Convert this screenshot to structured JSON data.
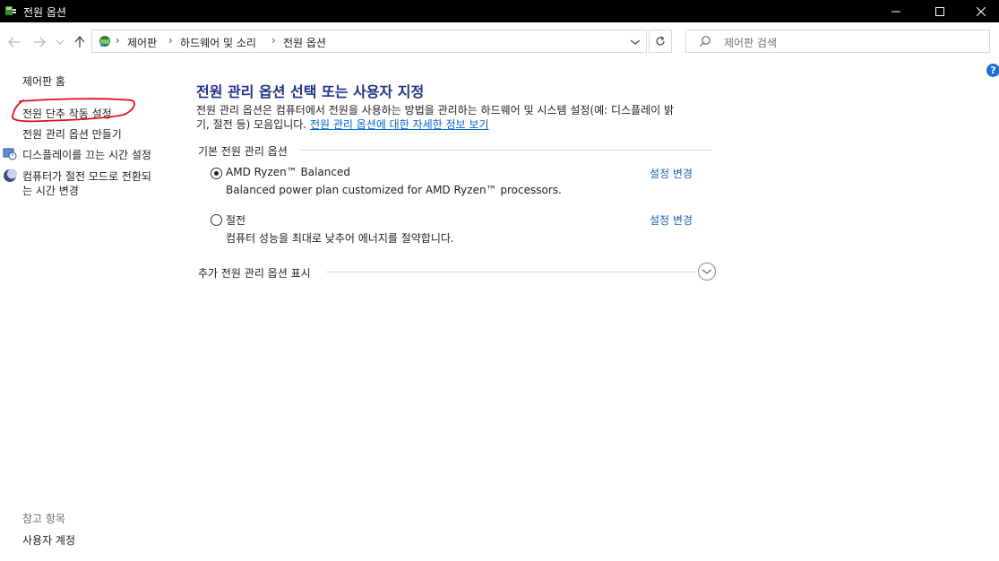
{
  "window": {
    "title": "전원 옵션"
  },
  "address": {
    "crumbs": [
      "제어판",
      "하드웨어 및 소리",
      "전원 옵션"
    ]
  },
  "search": {
    "placeholder": "제어판 검색"
  },
  "left_pane": {
    "home": "제어판 홈",
    "items": [
      "전원 단추 작동 설정",
      "전원 관리 옵션 만들기",
      "디스플레이를 끄는 시간 설정",
      "컴퓨터가 절전 모드로 전환되",
      "는 시간 변경"
    ],
    "see_also_heading": "참고 항목",
    "see_also_items": [
      "사용자 계정"
    ]
  },
  "main": {
    "title": "전원 관리 옵션 선택 또는 사용자 지정",
    "description_line1": "전원 관리 옵션은 컴퓨터에서 전원을 사용하는 방법을 관리하는 하드웨어 및 시스템 설정(예: 디스플레이 밝",
    "description_line2": "기, 절전 등) 모음입니다.",
    "description_link": "전원 관리 옵션에 대한 자세한 정보 보기",
    "group_heading": "기본 전원 관리 옵션",
    "plans": [
      {
        "name": "AMD Ryzen™ Balanced",
        "description": "Balanced power plan customized for AMD Ryzen™ processors.",
        "link": "설정 변경",
        "selected": true
      },
      {
        "name": "절전",
        "description": "컴퓨터 성능을 최대로 낮추어 에너지를 절약합니다.",
        "link": "설정 변경",
        "selected": false
      }
    ],
    "more_plans": "추가 전원 관리 옵션 표시"
  },
  "colors": {
    "title_blue": "#1e3287",
    "link_blue": "#0066cc",
    "annotation_red": "#e0101a"
  }
}
